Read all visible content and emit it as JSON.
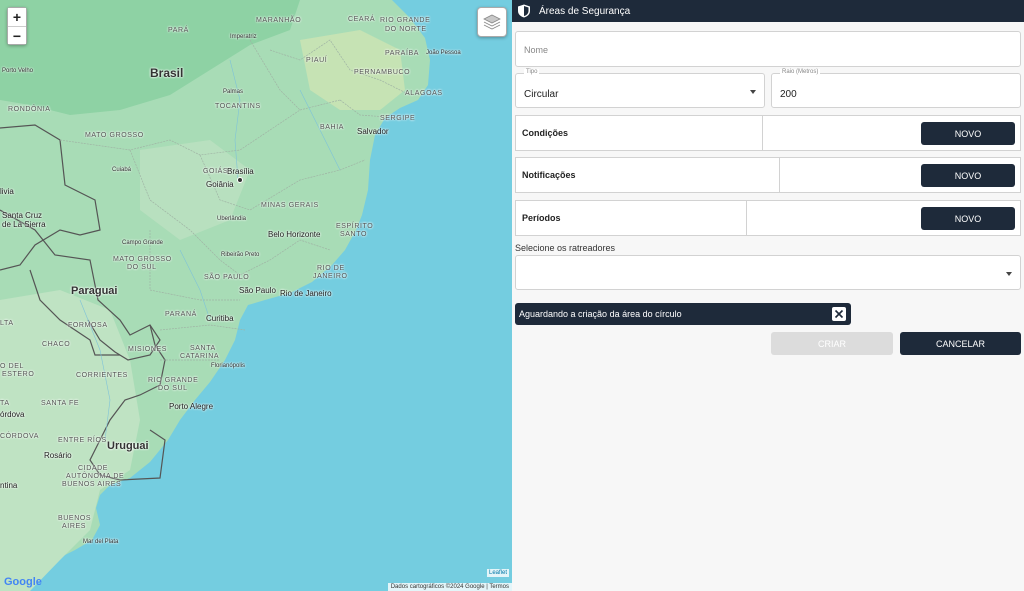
{
  "map": {
    "zoom_in": "+",
    "zoom_out": "−",
    "leaflet": "Leaflet",
    "attribution": "Dados cartográficos ©2024 Google",
    "terms": "Termos",
    "google": "Google",
    "labels": {
      "para": "PARÁ",
      "maranhao": "MARANHÃO",
      "ceara": "CEARÁ",
      "rio_grande_do_norte_1": "RIO GRANDE",
      "rio_grande_do_norte_2": "DO NORTE",
      "imperatriz": "Imperatriz",
      "joao_pessoa": "João Pessoa",
      "piaui": "PIAUÍ",
      "paraiba": "PARAÍBA",
      "porto_velho": "Porto Velho",
      "brasil": "Brasil",
      "pernambuco": "PERNAMBUCO",
      "palmas": "Palmas",
      "alagoas": "ALAGOAS",
      "rondonia": "RONDÔNIA",
      "tocantins": "TOCANTINS",
      "sergipe": "SERGIPE",
      "bahia": "BAHIA",
      "mato_grosso": "MATO GROSSO",
      "salvador": "Salvador",
      "cuiaba": "Cuiabá",
      "goias": "GOIÁS",
      "brasilia": "Brasília",
      "goiania": "Goiânia",
      "livia": "livia",
      "santa_cruz_1": "Santa Cruz",
      "santa_cruz_2": "de La Sierra",
      "uberlandia": "Uberlândia",
      "minas_gerais": "MINAS GERAIS",
      "espirito_santo_1": "ESPÍRITO",
      "espirito_santo_2": "SANTO",
      "campo_grande": "Campo Grande",
      "belo_horizonte": "Belo Horizonte",
      "ribeirao_preto": "Ribeirão Preto",
      "mato_grosso_do_sul_1": "MATO GROSSO",
      "mato_grosso_do_sul_2": "DO SUL",
      "rio_de_janeiro_state_1": "RIO DE",
      "rio_de_janeiro_state_2": "JANEIRO",
      "sao_paulo_state": "SÃO PAULO",
      "paraguai": "Paraguai",
      "sao_paulo": "São Paulo",
      "rio_de_janeiro": "Rio de Janeiro",
      "parana": "PARANÁ",
      "curitiba": "Curitiba",
      "formosa": "FORMOSA",
      "chaco": "CHACO",
      "misiones": "MISIONES",
      "santa_catarina_1": "SANTA",
      "santa_catarina_2": "CATARINA",
      "florianopolis": "Florianópolis",
      "del_estero_1": "O DEL",
      "del_estero_2": "ESTERO",
      "corrientes": "CORRIENTES",
      "rio_grande_do_sul_1": "RIO GRANDE",
      "rio_grande_do_sul_2": "DO SUL",
      "santa_fe": "SANTA FE",
      "porto_alegre": "Porto Alegre",
      "cordova_city": "órdova",
      "cordova_state": "CÓRDOVA",
      "entre_rios": "ENTRE RÍOS",
      "uruguai": "Uruguai",
      "rosario": "Rosário",
      "caba_1": "CIDADE",
      "caba_2": "AUTÔNOMA DE",
      "caba_3": "BUENOS AIRES",
      "ntina": "ntina",
      "buenos_aires_1": "BUENOS",
      "buenos_aires_2": "AIRES",
      "mar_del_plata": "Mar del Plata",
      "lta": "LTA",
      "ta": "TA"
    }
  },
  "panel": {
    "title": "Áreas de Segurança",
    "name_placeholder": "Nome",
    "tipo_label": "Tipo",
    "tipo_value": "Circular",
    "raio_label": "Raio (Metros)",
    "raio_value": "200",
    "rows": [
      {
        "label": "Condições",
        "button": "NOVO"
      },
      {
        "label": "Notificações",
        "button": "NOVO"
      },
      {
        "label": "Períodos",
        "button": "NOVO"
      }
    ],
    "trackers_label": "Selecione os ratreadores",
    "toast": "Aguardando a criação da área do círculo",
    "create": "CRIAR",
    "cancel": "CANCELAR"
  }
}
